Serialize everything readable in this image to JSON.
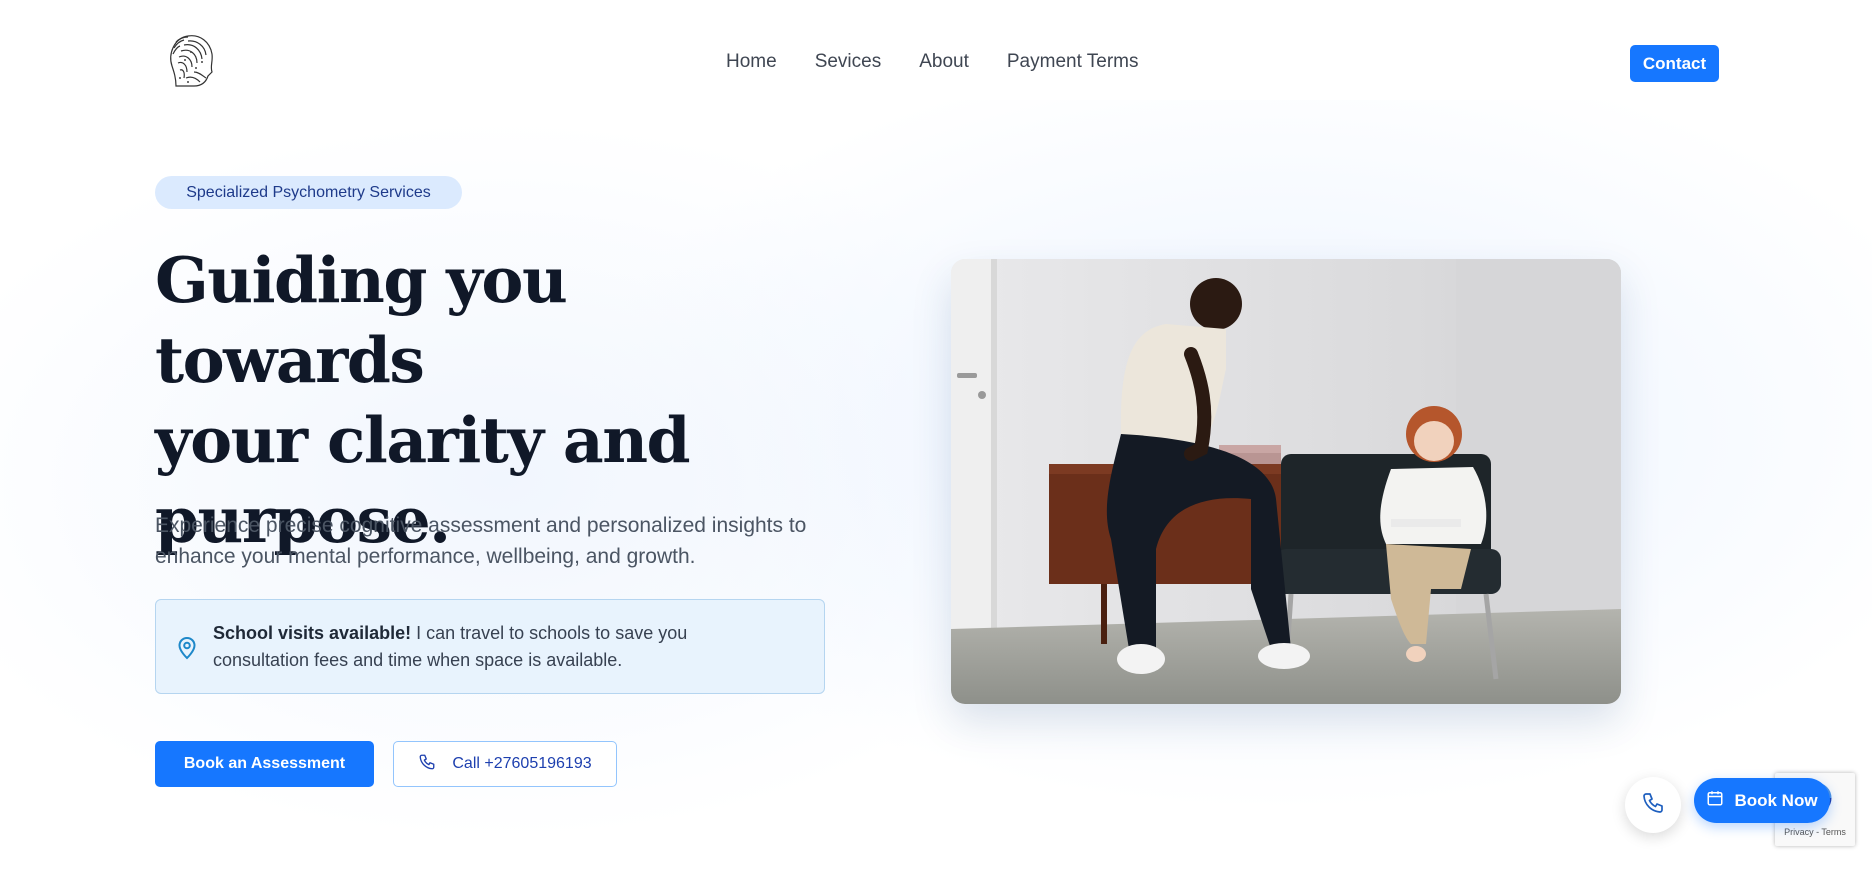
{
  "header": {
    "logo_icon": "fingerprint-head-icon",
    "nav": [
      "Home",
      "Sevices",
      "About",
      "Payment Terms"
    ],
    "contact_label": "Contact"
  },
  "hero": {
    "badge": "Specialized Psychometry Services",
    "headline_lines": [
      "Guiding you towards",
      "your clarity and",
      "purpose."
    ],
    "subtext": "Experience precise cognitive assessment and personalized insights to enhance your mental performance, wellbeing, and growth.",
    "notice": {
      "icon": "map-pin-icon",
      "bold": "School visits available!",
      "text": " I can travel to schools to save you consultation fees and time when space is available."
    },
    "primary_button": "Book an Assessment",
    "call_button": "Call +27605196193",
    "image_alt": "Man sitting beside a child writing in a notebook"
  },
  "floating": {
    "call_icon": "phone-icon",
    "book_now_label": "Book Now",
    "book_now_icon": "calendar-icon"
  },
  "recaptcha": {
    "text": "Privacy - Terms"
  },
  "colors": {
    "accent": "#1677ff",
    "heading": "#101828",
    "badge_bg": "#dbeafe",
    "notice_bg": "#e8f3fd"
  }
}
